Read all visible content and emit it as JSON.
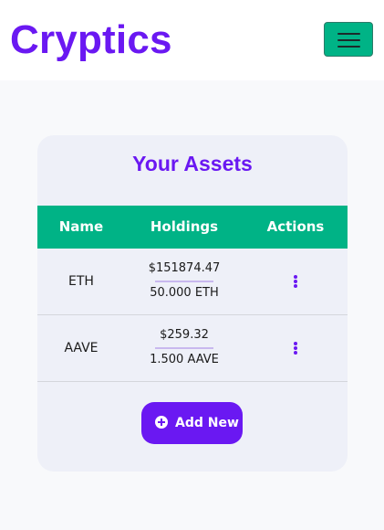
{
  "app": {
    "brand": "Cryptics",
    "menu_icon": "hamburger-menu-icon"
  },
  "assets": {
    "title": "Your Assets",
    "columns": [
      "Name",
      "Holdings",
      "Actions"
    ],
    "rows": [
      {
        "name": "ETH",
        "holdings_usd": "$151874.47",
        "holdings_qty": "50.000 ETH",
        "actions_icon": "more-vertical-icon"
      },
      {
        "name": "AAVE",
        "holdings_usd": "$259.32",
        "holdings_qty": "1.500 AAVE",
        "actions_icon": "more-vertical-icon"
      }
    ],
    "add_button": {
      "label": "Add New",
      "icon": "plus-circle-icon"
    }
  },
  "colors": {
    "accent": "#6a18f2",
    "header": "#00b386",
    "card": "#eef0f8",
    "background": "#f8f9fb"
  }
}
